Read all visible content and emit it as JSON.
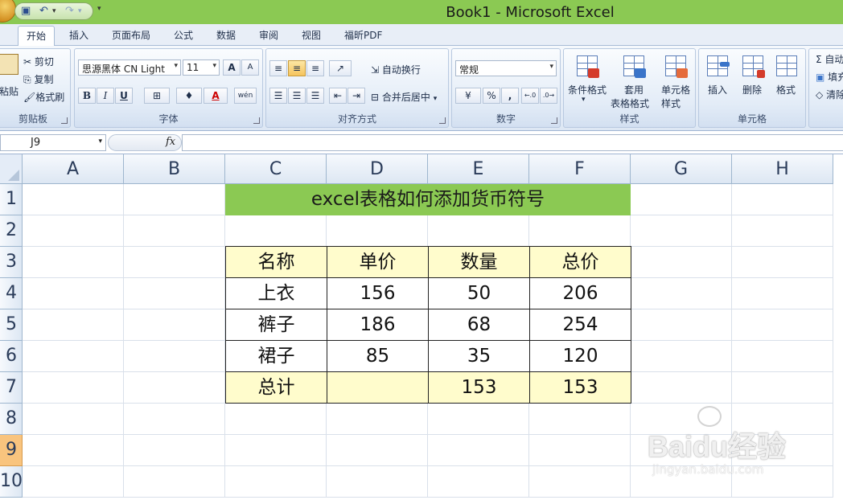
{
  "window": {
    "title": "Book1 - Microsoft Excel",
    "title_color": "#8bc953"
  },
  "tabs": [
    "开始",
    "插入",
    "页面布局",
    "公式",
    "数据",
    "审阅",
    "视图",
    "福昕PDF"
  ],
  "ribbon": {
    "clipboard": {
      "label": "剪贴板",
      "paste": "粘贴",
      "cut": "剪切",
      "copy": "复制",
      "format_painter": "格式刷"
    },
    "font": {
      "label": "字体",
      "font_name": "思源黑体 CN Light",
      "font_size": "11",
      "bold": "B",
      "italic": "I",
      "underline": "U",
      "grow": "A",
      "shrink": "A",
      "font_color_glyph": "A",
      "wen": "wén"
    },
    "alignment": {
      "label": "对齐方式",
      "wrap_text": "自动换行",
      "merge_center": "合并后居中"
    },
    "number": {
      "label": "数字",
      "format": "常规",
      "percent": "%",
      "comma": ","
    },
    "styles": {
      "label": "样式",
      "conditional": "条件格式",
      "table_format_1": "套用",
      "table_format_2": "表格格式",
      "cell_styles_1": "单元格",
      "cell_styles_2": "样式"
    },
    "cells": {
      "label": "单元格",
      "insert": "插入",
      "delete": "删除",
      "format": "格式"
    },
    "editing": {
      "sum": "Σ",
      "autosum": "自动",
      "fill": "填充",
      "clear": "清除"
    }
  },
  "formula_bar": {
    "name_box": "J9",
    "fx": "fx",
    "content": ""
  },
  "columns": [
    "A",
    "B",
    "C",
    "D",
    "E",
    "F",
    "G",
    "H"
  ],
  "rows": [
    "1",
    "2",
    "3",
    "4",
    "5",
    "6",
    "7",
    "8",
    "9",
    "10"
  ],
  "selected_row": "9",
  "sheet": {
    "title": "excel表格如何添加货币符号",
    "header": [
      "名称",
      "单价",
      "数量",
      "总价"
    ],
    "rows": [
      [
        "上衣",
        "156",
        "50",
        "206"
      ],
      [
        "裤子",
        "186",
        "68",
        "254"
      ],
      [
        "裙子",
        "85",
        "35",
        "120"
      ],
      [
        "总计",
        "",
        "153",
        "153"
      ]
    ],
    "header_fill": "#fffccc",
    "total_fill": "#fffccc"
  },
  "watermark": {
    "main": "Baidu经验",
    "sub": "jingyan.baidu.com"
  }
}
